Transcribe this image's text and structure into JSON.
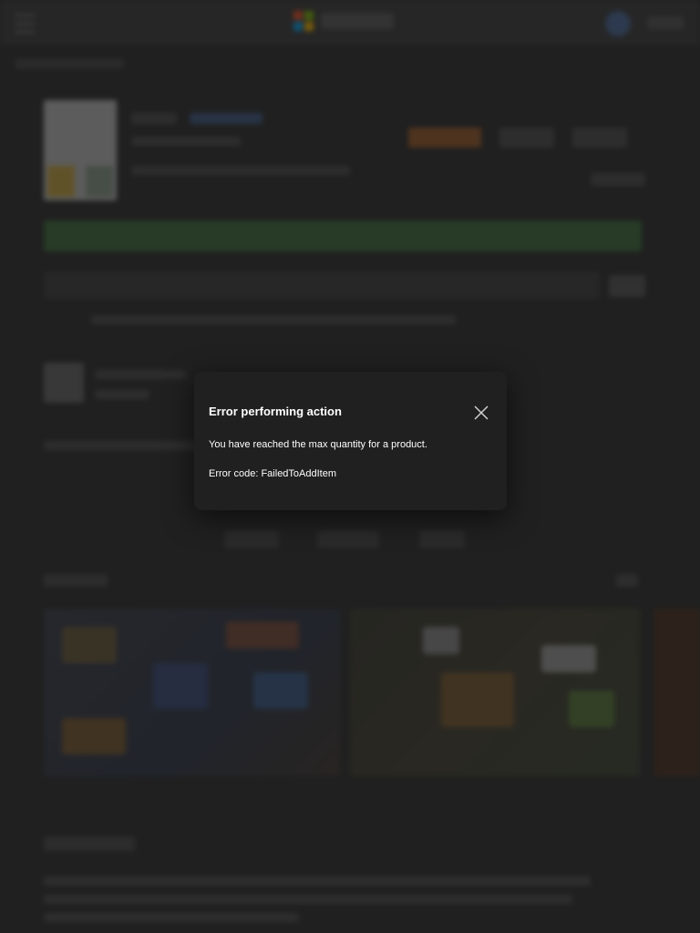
{
  "dialog": {
    "title": "Error performing action",
    "message": "You have reached the max quantity for a product.",
    "error_code": "Error code: FailedToAddItem",
    "close_icon": "close-icon"
  },
  "colors": {
    "dialog_bg": "#202020",
    "dialog_text": "#ffffff",
    "primary_button": "#3c6e3c",
    "logo": [
      "#f25022",
      "#7fba00",
      "#00a4ef",
      "#ffb900"
    ]
  }
}
